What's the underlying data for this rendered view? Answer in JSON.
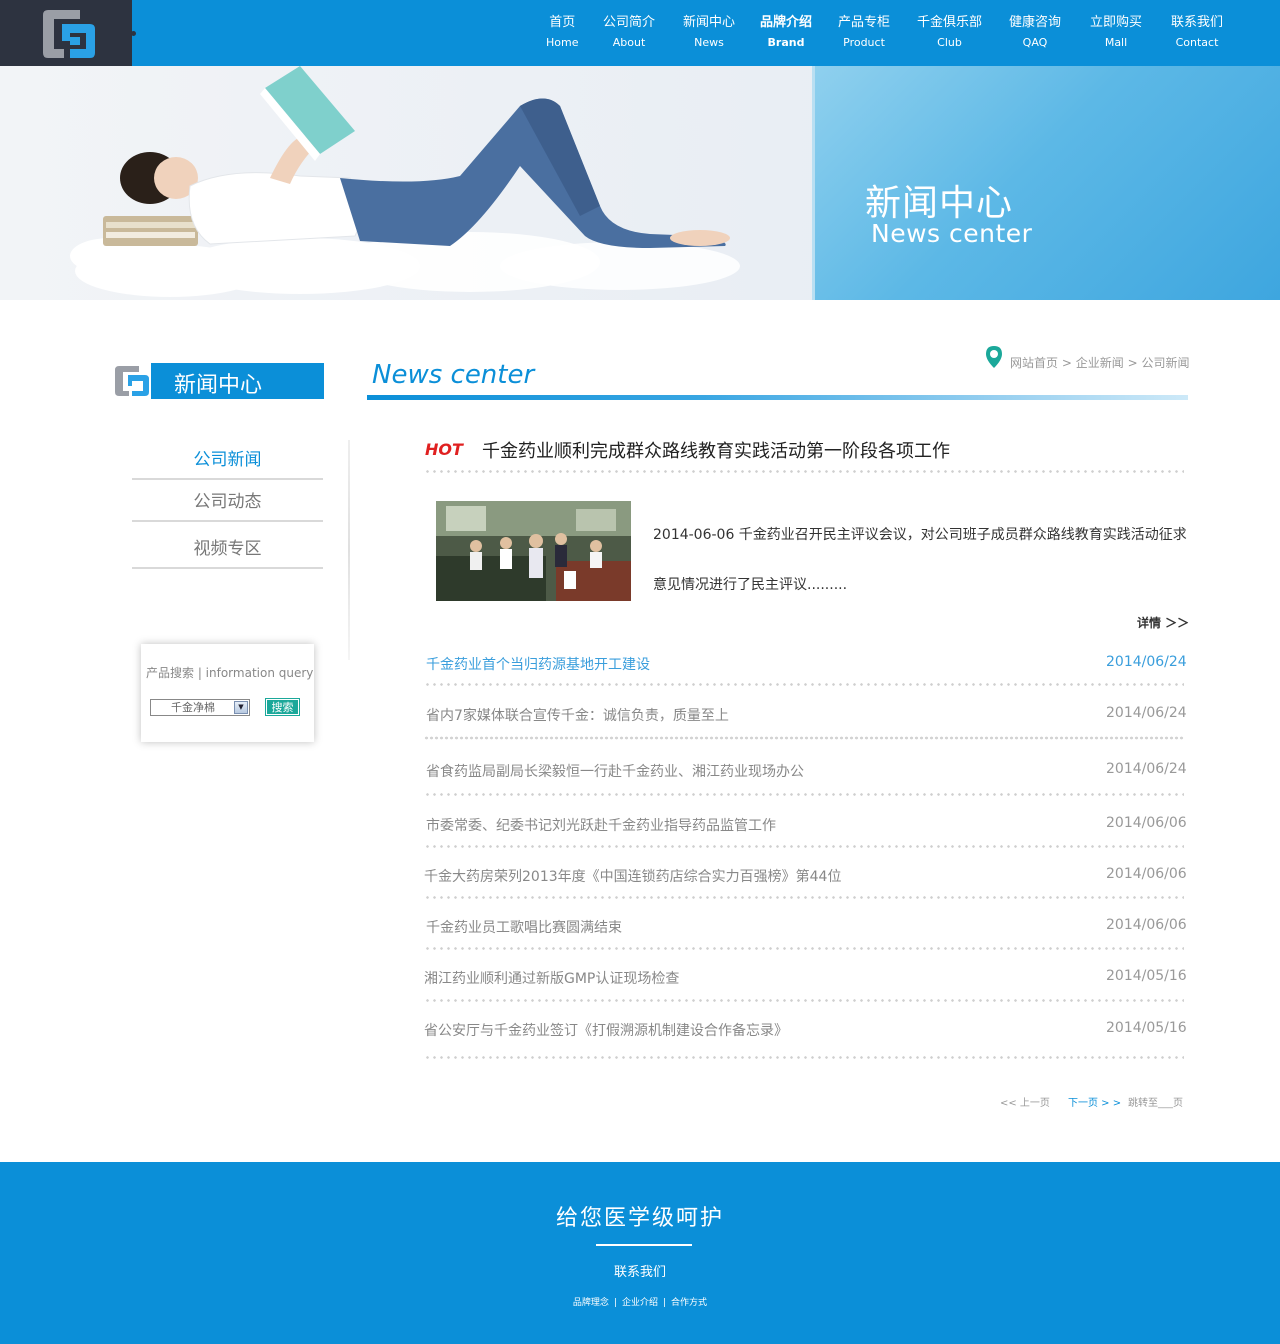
{
  "header": {
    "nav": [
      {
        "cn": "首页",
        "en": "Home",
        "active": false
      },
      {
        "cn": "公司简介",
        "en": "About",
        "active": false
      },
      {
        "cn": "新闻中心",
        "en": "News",
        "active": false
      },
      {
        "cn": "品牌介绍",
        "en": "Brand",
        "active": true
      },
      {
        "cn": "产品专柜",
        "en": "Product",
        "active": false
      },
      {
        "cn": "千金俱乐部",
        "en": "Club",
        "active": false
      },
      {
        "cn": "健康咨询",
        "en": "QAQ",
        "active": false
      },
      {
        "cn": "立即购买",
        "en": "Mall",
        "active": false
      },
      {
        "cn": "联系我们",
        "en": "Contact",
        "active": false
      }
    ]
  },
  "banner": {
    "title_cn": "新闻中心",
    "title_en": "News center"
  },
  "sidebar": {
    "title": "新闻中心",
    "menu": [
      {
        "label": "公司新闻",
        "active": true
      },
      {
        "label": "公司动态",
        "active": false
      },
      {
        "label": "视频专区",
        "active": false
      }
    ],
    "search": {
      "label": "产品搜索 | information query",
      "selected": "千金净棉",
      "button": "搜索"
    }
  },
  "main": {
    "title": "News center",
    "breadcrumb": [
      "网站首页",
      "企业新闻",
      "公司新闻"
    ],
    "breadcrumb_sep": ">",
    "hot_label": "HOT",
    "headline": "千金药业顺利完成群众路线教育实践活动第一阶段各项工作",
    "feature_text": "2014-06-06 千金药业召开民主评议会议，对公司班子成员群众路线教育实践活动征求意见情况进行了民主评议.........",
    "more": "详情 ＞＞",
    "news": [
      {
        "title": "千金药业首个当归药源基地开工建设",
        "date": "2014/06/24"
      },
      {
        "title": "省内7家媒体联合宣传千金：诚信负责，质量至上",
        "date": "2014/06/24"
      },
      {
        "title": "省食药监局副局长梁毅恒一行赴千金药业、湘江药业现场办公",
        "date": "2014/06/24"
      },
      {
        "title": "市委常委、纪委书记刘光跃赴千金药业指导药品监管工作",
        "date": "2014/06/06"
      },
      {
        "title": "千金大药房荣列2013年度《中国连锁药店综合实力百强榜》第44位",
        "date": "2014/06/06"
      },
      {
        "title": "千金药业员工歌唱比赛圆满结束",
        "date": "2014/06/06"
      },
      {
        "title": "湘江药业顺利通过新版GMP认证现场检查",
        "date": "2014/05/16"
      },
      {
        "title": "省公安厅与千金药业签订《打假溯源机制建设合作备忘录》",
        "date": "2014/05/16"
      }
    ],
    "pager": {
      "prev": "<< 上一页",
      "next": "下一页 > >",
      "jump": "跳转至___页"
    }
  },
  "footer": {
    "slogan": "给您医学级呵护",
    "contact": "联系我们",
    "links": [
      "品牌理念",
      "企业介绍",
      "合作方式"
    ],
    "link_sep": "|"
  },
  "colors": {
    "brand_blue": "#0b8fd8",
    "logo_dark": "#2d3340",
    "search_button": "#1ba89a",
    "hot_red": "#e02020"
  },
  "icons": {
    "logo": "qianjin-logo",
    "breadcrumb": "location-pin-icon",
    "select_arrow": "chevron-down-icon"
  }
}
